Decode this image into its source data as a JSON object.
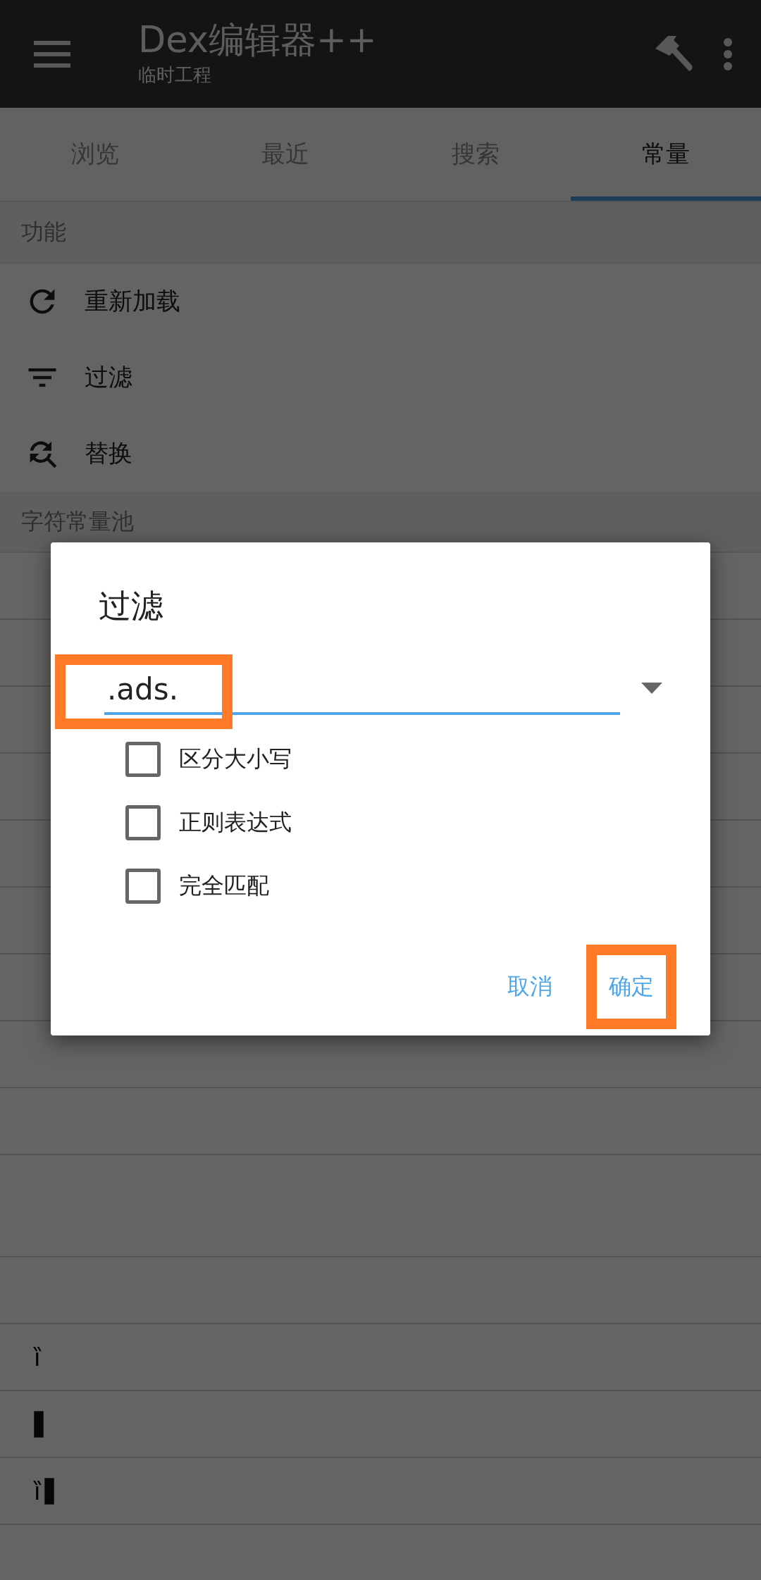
{
  "app_bar": {
    "title": "Dex编辑器++",
    "subtitle": "临时工程"
  },
  "tabs": [
    {
      "label": "浏览",
      "selected": false
    },
    {
      "label": "最近",
      "selected": false
    },
    {
      "label": "搜索",
      "selected": false
    },
    {
      "label": "常量",
      "selected": true
    }
  ],
  "functions": {
    "header": "功能",
    "items": [
      {
        "label": "重新加载",
        "kind": "reload"
      },
      {
        "label": "过滤",
        "kind": "filter"
      },
      {
        "label": "替换",
        "kind": "replace"
      }
    ]
  },
  "string_pool": {
    "header": "字符常量池",
    "rows": [
      {
        "kind": "blank"
      },
      {
        "kind": "blank"
      },
      {
        "kind": "blank"
      },
      {
        "kind": "blank"
      },
      {
        "kind": "blank"
      },
      {
        "kind": "blank"
      },
      {
        "kind": "blank"
      },
      {
        "kind": "blank"
      },
      {
        "kind": "blank"
      },
      {
        "kind": "tall"
      },
      {
        "kind": "blank"
      },
      {
        "kind": "text",
        "text": "ȉ",
        "missing_glyph": false
      },
      {
        "kind": "text",
        "missing_glyph": true
      },
      {
        "kind": "text",
        "text": "ȉ",
        "missing_glyph": true
      },
      {
        "kind": "blank"
      }
    ]
  },
  "dialog": {
    "title": "过滤",
    "field": {
      "value": ".ads.",
      "highlighted": true
    },
    "options": [
      {
        "label": "区分大小写",
        "checked": false
      },
      {
        "label": "正则表达式",
        "checked": false
      },
      {
        "label": "完全匹配",
        "checked": false
      }
    ],
    "buttons": [
      {
        "label": "取消",
        "highlighted": false
      },
      {
        "label": "确定",
        "highlighted": true
      }
    ]
  }
}
